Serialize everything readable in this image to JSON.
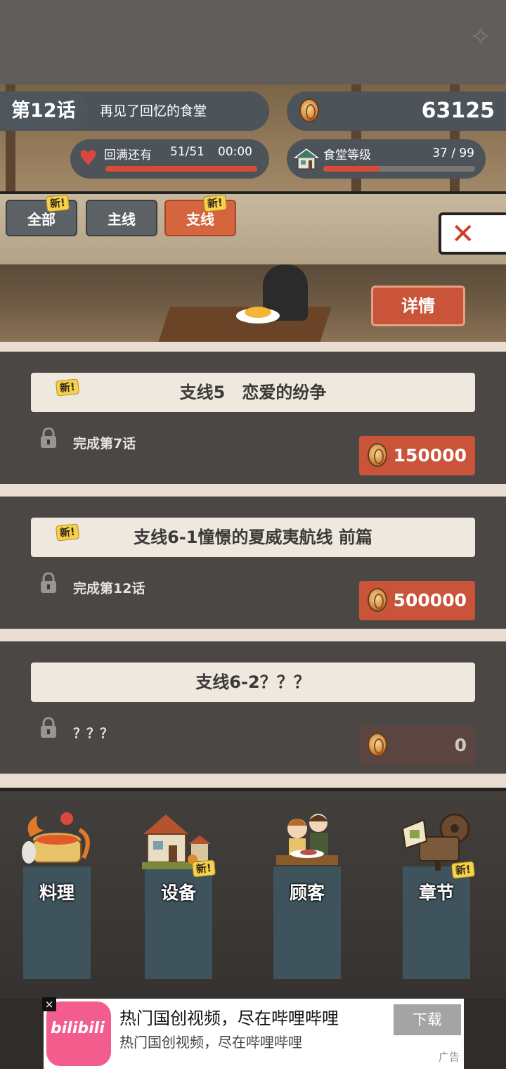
{
  "header": {
    "chapter_number": "第12话",
    "chapter_title": "再见了回忆的食堂",
    "coins": "63125",
    "stamina_label": "回满还有",
    "stamina_value": "51/51",
    "stamina_timer": "00:00",
    "stamina_fill": 1.0,
    "canteen_level_label": "食堂等级",
    "canteen_level_value": "37 / 99",
    "canteen_level_fill": 0.37
  },
  "filters": {
    "tabs": [
      {
        "label": "全部",
        "badge": "新!",
        "active": false
      },
      {
        "label": "主线",
        "badge": "",
        "active": false
      },
      {
        "label": "支线",
        "badge": "新!",
        "active": true
      }
    ],
    "close_icon": "close-x-icon"
  },
  "scene": {
    "detail_label": "详情"
  },
  "quests": [
    {
      "badge": "新!",
      "title": "支线5　恋爱的纷争",
      "requirement": "完成第7话",
      "cost": "150000",
      "locked_cost": false
    },
    {
      "badge": "新!",
      "title": "支线6-1憧憬的夏威夷航线 前篇",
      "requirement": "完成第12话",
      "cost": "500000",
      "locked_cost": false
    },
    {
      "badge": "",
      "title": "支线6-2？？？",
      "requirement": "？？？",
      "cost": "0",
      "locked_cost": true
    }
  ],
  "nav": [
    {
      "label": "料理",
      "badge": ""
    },
    {
      "label": "设备",
      "badge": "新!"
    },
    {
      "label": "顾客",
      "badge": ""
    },
    {
      "label": "章节",
      "badge": "新!"
    }
  ],
  "ad": {
    "logo_text": "bilibili",
    "title": "热门国创视频，尽在哔哩哔哩",
    "subtitle": "热门国创视频，尽在哔哩哔哩",
    "button": "下载",
    "tag": "广告",
    "close": "×"
  },
  "colors": {
    "accent": "#d5653e",
    "panel": "#4a4744",
    "coin": "#d8934a"
  }
}
